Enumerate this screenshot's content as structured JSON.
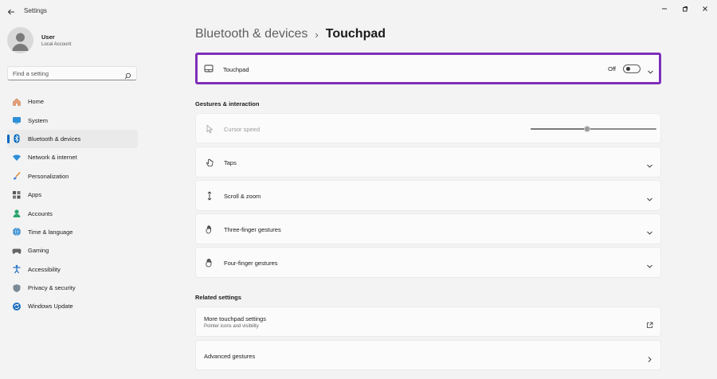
{
  "window": {
    "app_title": "Settings"
  },
  "user": {
    "name": "User",
    "account_type": "Local Account"
  },
  "search": {
    "placeholder": "Find a setting"
  },
  "nav": [
    {
      "label": "Home",
      "icon": "home-icon"
    },
    {
      "label": "System",
      "icon": "system-icon"
    },
    {
      "label": "Bluetooth & devices",
      "icon": "bluetooth-icon",
      "selected": true
    },
    {
      "label": "Network & internet",
      "icon": "wifi-icon"
    },
    {
      "label": "Personalization",
      "icon": "brush-icon"
    },
    {
      "label": "Apps",
      "icon": "apps-icon"
    },
    {
      "label": "Accounts",
      "icon": "person-icon"
    },
    {
      "label": "Time & language",
      "icon": "globe-icon"
    },
    {
      "label": "Gaming",
      "icon": "gamepad-icon"
    },
    {
      "label": "Accessibility",
      "icon": "accessibility-icon"
    },
    {
      "label": "Privacy & security",
      "icon": "shield-icon"
    },
    {
      "label": "Windows Update",
      "icon": "update-icon"
    }
  ],
  "breadcrumb": {
    "parent": "Bluetooth & devices",
    "separator": "›",
    "current": "Touchpad"
  },
  "touchpad": {
    "label": "Touchpad",
    "state_label": "Off",
    "enabled": false
  },
  "gestures": {
    "section_title": "Gestures & interaction",
    "cursor_speed": {
      "label": "Cursor speed",
      "value_fraction": 0.45,
      "disabled": true
    },
    "taps": {
      "label": "Taps"
    },
    "scroll_zoom": {
      "label": "Scroll & zoom"
    },
    "three_finger": {
      "label": "Three-finger gestures"
    },
    "four_finger": {
      "label": "Four-finger gestures"
    }
  },
  "related": {
    "section_title": "Related settings",
    "more_touchpad": {
      "label": "More touchpad settings",
      "sublabel": "Pointer icons and visibility"
    },
    "advanced_gestures": {
      "label": "Advanced gestures"
    }
  },
  "colors": {
    "accent": "#0067c0",
    "highlight_border": "#7e2fb8"
  }
}
